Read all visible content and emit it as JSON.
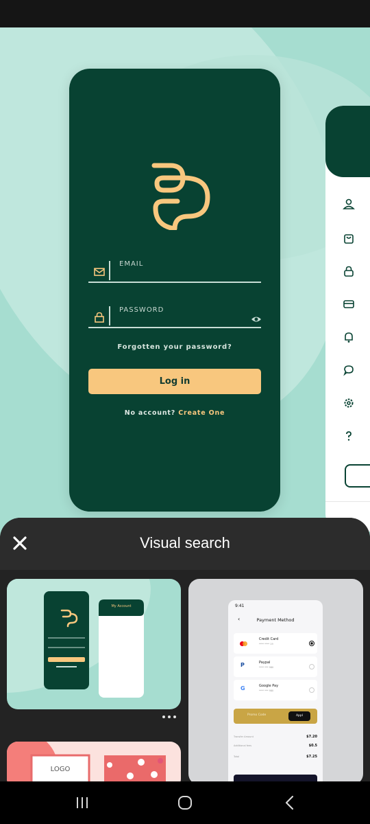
{
  "login_mock": {
    "email_label": "EMAIL",
    "password_label": "PASSWORD",
    "forgot_text": "Forgotten your password?",
    "login_label": "Log in",
    "signup_prefix": "No account?",
    "signup_link": "Create One"
  },
  "sheet": {
    "title": "Visual search"
  },
  "result1": {
    "card_title": "My Account"
  },
  "result2": {
    "status_time": "9:41",
    "page_title": "Payment Method",
    "methods": [
      {
        "name": "Credit Card",
        "detail": "**** **** 19"
      },
      {
        "name": "Paypal",
        "detail": "**** *** 980"
      },
      {
        "name": "Google Pay",
        "detail": "**** *** 980"
      }
    ],
    "promo_label": "Promo Code",
    "apply_label": "Appl",
    "totals": [
      {
        "label": "Transfer Amount",
        "value": "$7.20"
      },
      {
        "label": "Additional fees",
        "value": "$0.5"
      },
      {
        "label": "Total",
        "value": "$7.25"
      }
    ]
  },
  "result3": {
    "logo_text": "LOGO"
  },
  "colors": {
    "mint": "#a6ddd0",
    "forest": "#084232",
    "peach": "#f8c77e",
    "sheet": "#232323"
  }
}
